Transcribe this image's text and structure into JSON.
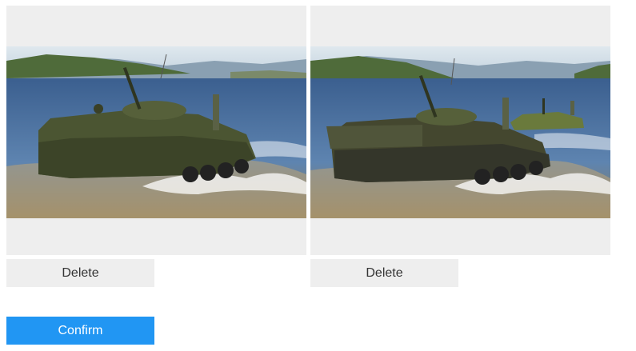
{
  "images": [
    {
      "delete_label": "Delete",
      "alt": "amphibious armored vehicle in water"
    },
    {
      "delete_label": "Delete",
      "alt": "amphibious armored vehicles in water"
    }
  ],
  "confirm_label": "Confirm",
  "colors": {
    "card_bg": "#eeeeee",
    "delete_bg": "#eeeeee",
    "delete_text": "#333333",
    "confirm_bg": "#2196f3",
    "confirm_text": "#ffffff"
  }
}
